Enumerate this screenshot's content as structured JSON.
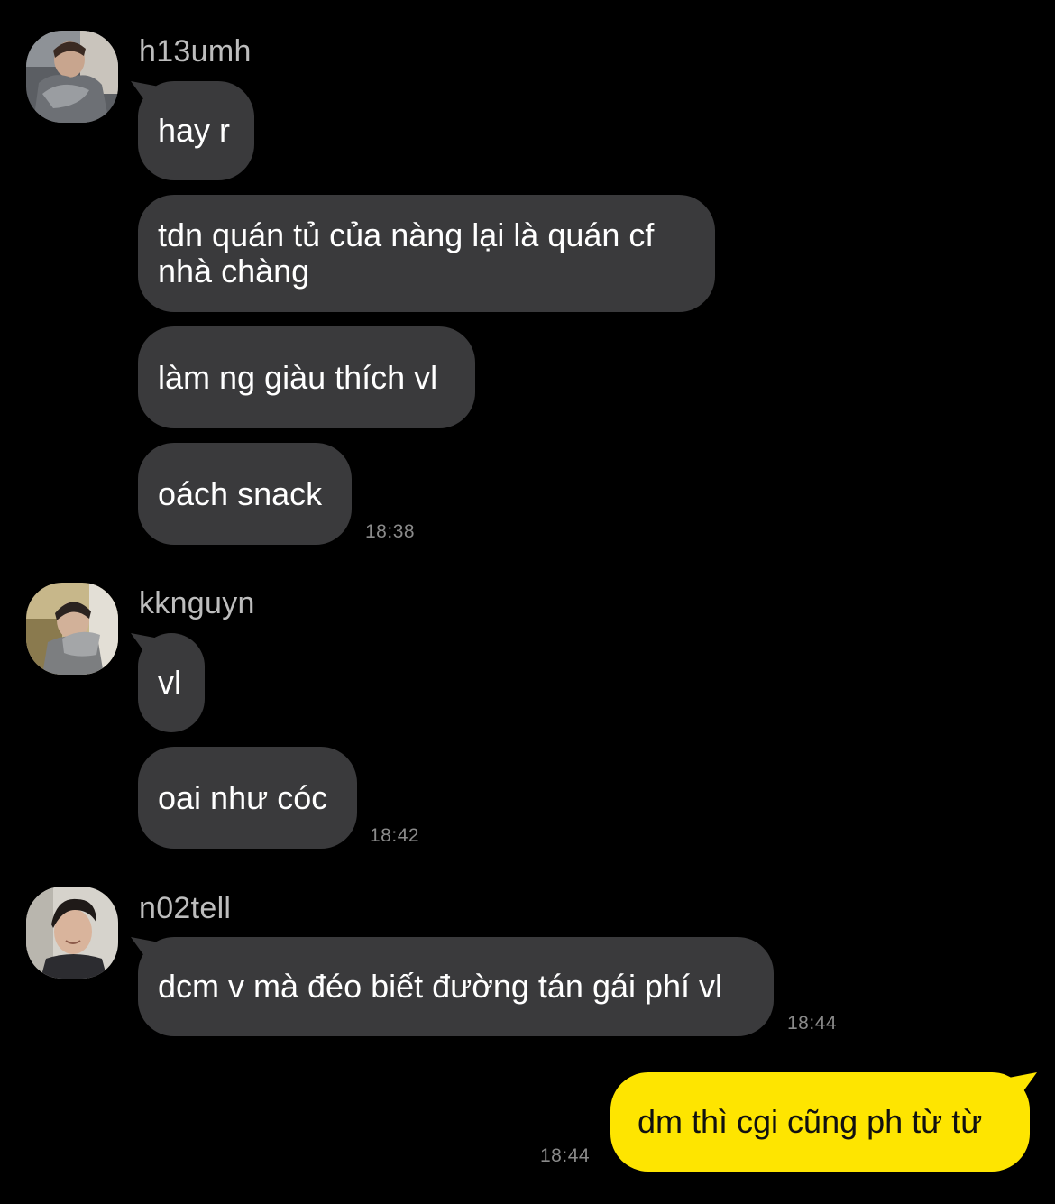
{
  "conversation": {
    "groups": [
      {
        "sender": "h13umh",
        "avatar_icon": "profile-photo-icon",
        "messages": [
          "hay r",
          "tdn quán tủ của nàng lại là quán cf nhà chàng",
          "làm ng giàu thích vl",
          "oách snack"
        ],
        "time": "18:38"
      },
      {
        "sender": "kknguyn",
        "avatar_icon": "profile-photo-icon",
        "messages": [
          "vl",
          "oai như cóc"
        ],
        "time": "18:42"
      },
      {
        "sender": "n02tell",
        "avatar_icon": "profile-photo-icon",
        "messages": [
          "dcm v mà đéo biết đường tán gái phí vl"
        ],
        "time": "18:44"
      }
    ],
    "outgoing": {
      "message": "dm thì cgi cũng ph từ từ",
      "time": "18:44"
    }
  },
  "colors": {
    "background": "#000000",
    "incoming_bubble": "#3a3a3c",
    "outgoing_bubble": "#fee500",
    "outgoing_text": "#111111",
    "sender_name": "#bdbdbd",
    "timestamp": "#8a8a8a"
  }
}
